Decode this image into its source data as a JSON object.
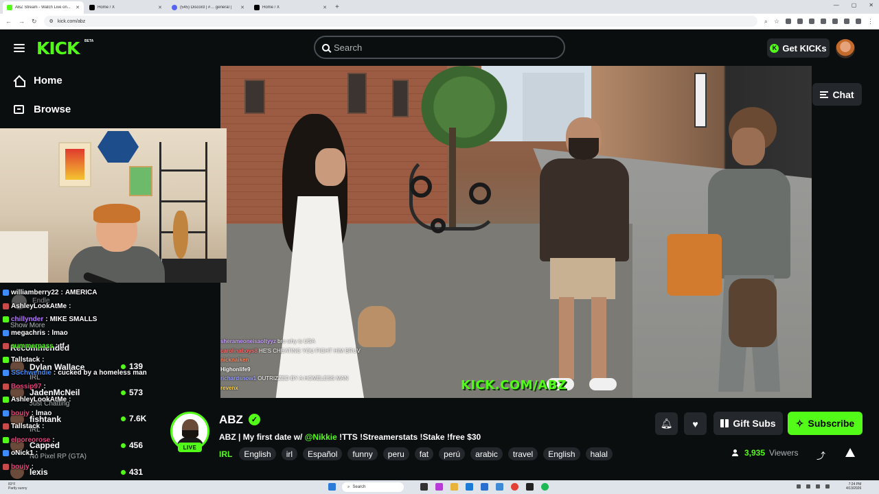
{
  "browser": {
    "tabs": [
      {
        "label": "ABZ Stream - Watch Live on...",
        "active": true,
        "icon": "kick-favicon"
      },
      {
        "label": "Home / X",
        "active": false,
        "icon": "x-favicon"
      },
      {
        "label": "(545) Discord | #… general |",
        "active": false,
        "icon": "discord-favicon"
      },
      {
        "label": "Home / X",
        "active": false,
        "icon": "x-favicon"
      }
    ],
    "new_tab": "+",
    "url": "kick.com/abz"
  },
  "header": {
    "logo": "KICK",
    "beta": "BETA",
    "search_placeholder": "Search",
    "get_kicks_label": "Get KICKs"
  },
  "sidebar": {
    "items": [
      {
        "label": "Home",
        "icon": "home-icon"
      },
      {
        "label": "Browse",
        "icon": "browse-icon"
      }
    ],
    "followed_partial": "Endle",
    "show_more": "Show More",
    "recommended_title": "Recommended",
    "recommended": [
      {
        "name": "Dylan Wallace",
        "category": "IRL",
        "viewers": "139"
      },
      {
        "name": "JadenMcNeil",
        "category": "Just Chatting",
        "viewers": "573"
      },
      {
        "name": "fishtank",
        "category": "IRL",
        "viewers": "7.6K"
      },
      {
        "name": "Capped",
        "category": "No Pixel RP (GTA)",
        "viewers": "456"
      },
      {
        "name": "lexis",
        "category": "",
        "viewers": "431"
      }
    ]
  },
  "overlay_chat": [
    {
      "user": "williamberry22",
      "msg": "AMERICA",
      "color": "#ffffff"
    },
    {
      "user": "AshleyLookAtMe",
      "msg": "",
      "color": "#ffffff"
    },
    {
      "user": "chillynder",
      "msg": "MIKE SMALLS",
      "color": "#b57bff"
    },
    {
      "user": "megachris",
      "msg": "lmao",
      "color": "#ffffff"
    },
    {
      "user": "summerpass",
      "msg": "tf",
      "color": "#53fc18"
    },
    {
      "user": "Tallstack",
      "msg": "",
      "color": "#ffffff"
    },
    {
      "user": "SSchwendie",
      "msg": "cucked by a homeless man",
      "color": "#3d8bfd"
    },
    {
      "user": "Bossip97",
      "msg": "",
      "color": "#e8417a"
    },
    {
      "user": "AshleyLookAtMe",
      "msg": "",
      "color": "#ffffff"
    },
    {
      "user": "boujy",
      "msg": "lmao",
      "color": "#e8417a"
    },
    {
      "user": "Tallstack",
      "msg": "",
      "color": "#ffffff"
    },
    {
      "user": "elporeorose",
      "msg": "",
      "color": "#e8417a"
    },
    {
      "user": "oNick1",
      "msg": "",
      "color": "#ffffff"
    },
    {
      "user": "boujy",
      "msg": "",
      "color": "#e8417a"
    }
  ],
  "video_chat": [
    {
      "user": "sherameoneisaoltyyz",
      "msg": "bro why is USA"
    },
    {
      "user": "carolinaboys8",
      "msg": "HE'S CHEATING YOU FIGHT HIM BRUV"
    },
    {
      "user": "nicknaiken",
      "msg": ""
    },
    {
      "user": "Highonlife9",
      "msg": ""
    },
    {
      "user": "richardsnow1",
      "msg": "OUTRIZZED BY A HOMELESS MAN"
    },
    {
      "user": "revenx",
      "msg": ""
    }
  ],
  "video_watermark": "KICK.COM/ABZ",
  "chat_toggle_label": "Chat",
  "channel": {
    "name": "ABZ",
    "live_badge": "LIVE",
    "title_prefix": "ABZ | My first date w/ ",
    "title_mention": "@Nikkie",
    "title_suffix": " !TTS !Streamerstats !Stake !free $30",
    "category": "IRL",
    "tags": [
      "English",
      "irl",
      "Español",
      "funny",
      "peru",
      "fat",
      "perú",
      "arabic",
      "travel",
      "English",
      "halal"
    ],
    "viewers_count": "3,935",
    "viewers_label": "Viewers",
    "gift_subs_label": "Gift Subs",
    "subscribe_label": "Subscribe"
  },
  "taskbar": {
    "weather_temp": "83°F",
    "weather_desc": "Partly sunny",
    "search_label": "Search",
    "time": "7:24 PM",
    "date": "4/13/2026"
  },
  "colors": {
    "accent": "#53fc18",
    "background": "#0b0e0f",
    "panel": "#24272c"
  }
}
